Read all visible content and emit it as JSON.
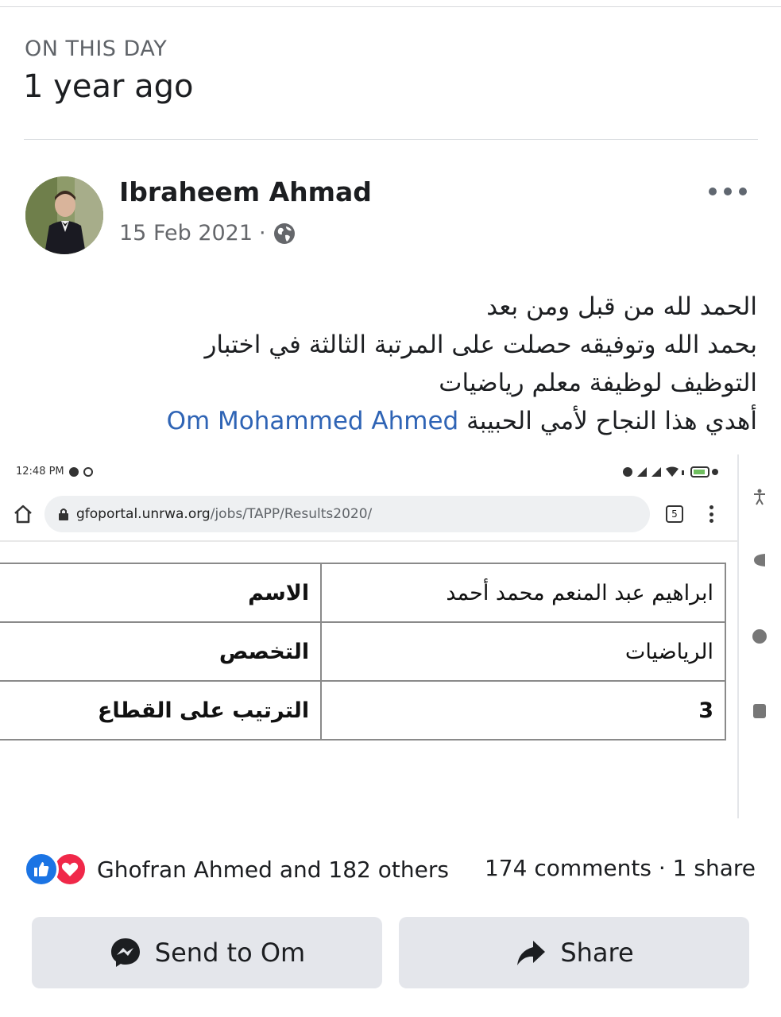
{
  "memory": {
    "label": "ON THIS DAY",
    "title": "1 year ago"
  },
  "post": {
    "author": "Ibraheem Ahmad",
    "date": "15 Feb 2021",
    "separator": "·",
    "audience_icon": "globe-icon",
    "more_icon": "more-options-icon",
    "text_lines": [
      "الحمد لله من قبل ومن بعد",
      "بحمد الله وتوفيقه حصلت على المرتبة الثالثة في اختبار",
      "التوظيف لوظيفة معلم رياضيات"
    ],
    "dedication_text": "أهدي هذا النجاح لأمي الحبيبة",
    "mention": "Om Mohammed Ahmed"
  },
  "attachment": {
    "status_time": "12:48 PM",
    "battery": "70",
    "url_host": "gfoportal.unrwa.org",
    "url_path": "/jobs/TAPP/Results2020/",
    "tabs_count": "5",
    "table": [
      {
        "key": "الاسم",
        "value": "ابراهيم عبد المنعم محمد أحمد"
      },
      {
        "key": "التخصص",
        "value": "الرياضيات"
      },
      {
        "key": "الترتيب على القطاع",
        "value": "3"
      }
    ]
  },
  "engagement": {
    "reactions_text": "Ghofran Ahmed and 182 others",
    "comments": "174 comments",
    "dot": "·",
    "shares": "1 share",
    "reaction_icons": [
      "like-icon",
      "love-icon"
    ]
  },
  "actions": {
    "send_label": "Send to Om",
    "share_label": "Share"
  },
  "colors": {
    "mention": "#2f64b5",
    "like": "#1b74e4",
    "love": "#f02849",
    "button_bg": "#e4e6eb"
  }
}
